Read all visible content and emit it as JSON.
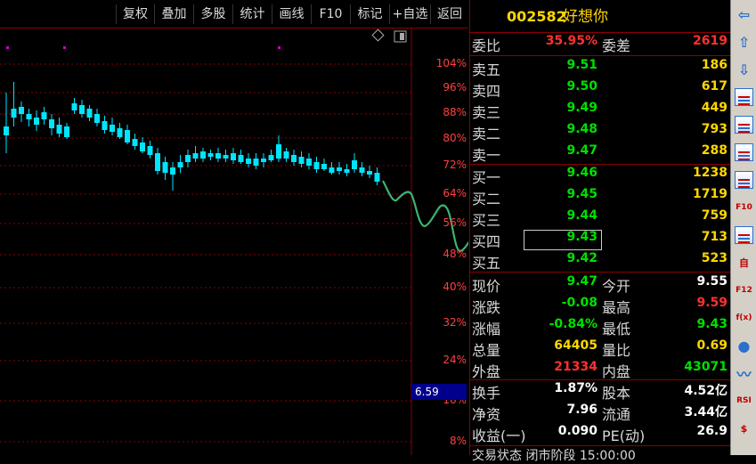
{
  "toolbar": {
    "items": [
      "复权",
      "叠加",
      "多股",
      "统计",
      "画线",
      "F10",
      "标记",
      "+自选",
      "返回"
    ]
  },
  "chart": {
    "y_labels": [
      "104%",
      "96%",
      "88%",
      "80%",
      "72%",
      "64%",
      "56%",
      "48%",
      "40%",
      "32%",
      "24%",
      "16%",
      "8%"
    ],
    "price_badge": "6.59",
    "colors": {
      "up": "#ff3030",
      "down": "#00e5ff",
      "annotation": "#3cb371",
      "axis": "#8b0000"
    }
  },
  "quote": {
    "code": "002582",
    "name": "好想你",
    "webi_label": "委比",
    "webi_value": "35.95%",
    "weicha_label": "委差",
    "weicha_value": "2619",
    "asks": [
      {
        "label": "卖五",
        "price": "9.51",
        "vol": "186"
      },
      {
        "label": "卖四",
        "price": "9.50",
        "vol": "617"
      },
      {
        "label": "卖三",
        "price": "9.49",
        "vol": "449"
      },
      {
        "label": "卖二",
        "price": "9.48",
        "vol": "793"
      },
      {
        "label": "卖一",
        "price": "9.47",
        "vol": "288"
      }
    ],
    "bids": [
      {
        "label": "买一",
        "price": "9.46",
        "vol": "1238"
      },
      {
        "label": "买二",
        "price": "9.45",
        "vol": "1719"
      },
      {
        "label": "买三",
        "price": "9.44",
        "vol": "759"
      },
      {
        "label": "买四",
        "price": "9.43",
        "vol": "713"
      },
      {
        "label": "买五",
        "price": "9.42",
        "vol": "523"
      }
    ],
    "stats": [
      {
        "l1": "现价",
        "v1": "9.47",
        "c1": "#00e000",
        "l2": "今开",
        "v2": "9.55",
        "c2": "#ffffff"
      },
      {
        "l1": "涨跌",
        "v1": "-0.08",
        "c1": "#00e000",
        "l2": "最高",
        "v2": "9.59",
        "c2": "#ff3030"
      },
      {
        "l1": "涨幅",
        "v1": "-0.84%",
        "c1": "#00e000",
        "l2": "最低",
        "v2": "9.43",
        "c2": "#00e000"
      },
      {
        "l1": "总量",
        "v1": "64405",
        "c1": "#ffd700",
        "l2": "量比",
        "v2": "0.69",
        "c2": "#ffd700"
      },
      {
        "l1": "外盘",
        "v1": "21334",
        "c1": "#ff3030",
        "l2": "内盘",
        "v2": "43071",
        "c2": "#00e000"
      }
    ],
    "stats2": [
      {
        "l1": "换手",
        "v1": "1.87%",
        "l2": "股本",
        "v2": "4.52亿"
      },
      {
        "l1": "净资",
        "v1": "7.96",
        "l2": "流通",
        "v2": "3.44亿"
      },
      {
        "l1": "收益(一)",
        "v1": "0.090",
        "l2": "PE(动)",
        "v2": "26.9"
      }
    ],
    "bottom_text": "交易状态 闭市阶段 15:00:00"
  },
  "sidebar": {
    "icons": [
      "arrow-left-icon",
      "arrow-up-icon",
      "arrow-down-icon",
      "list-icon",
      "grid-icon",
      "line-chart-icon",
      "candle-chart-icon",
      "f10-icon",
      "info-icon",
      "self-select-icon",
      "f12-icon",
      "function-icon",
      "circle-icon",
      "wave-icon",
      "rsi-icon",
      "dollar-icon"
    ],
    "labels": [
      "",
      "",
      "",
      "",
      "",
      "",
      "",
      "F10",
      "",
      "自",
      "F12",
      "f(x)",
      "",
      "",
      "RSI",
      "$"
    ]
  }
}
